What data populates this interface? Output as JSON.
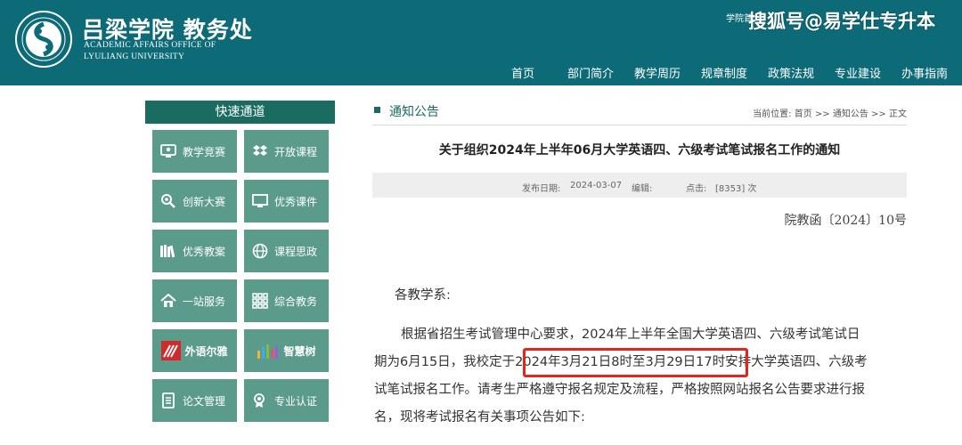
{
  "header": {
    "logo_cn": "吕梁学院 教务处",
    "logo_en_line1": "ACADEMIC AFFAIRS OFFICE OF",
    "logo_en_line2": "LYULIANG UNIVERSITY",
    "top_links": "学院首",
    "watermark": "搜狐号@易学仕专升本",
    "brand_color": "#0d6b77",
    "nav": [
      "首页",
      "部门简介",
      "教学周历",
      "规章制度",
      "政策法规",
      "专业建设",
      "办事指南"
    ]
  },
  "sidebar": {
    "title": "快速通道",
    "items": [
      {
        "label": "教学竞赛",
        "icon": "monitor-person-icon"
      },
      {
        "label": "开放课程",
        "icon": "dropbox-icon"
      },
      {
        "label": "创新大赛",
        "icon": "lightbulb-search-icon"
      },
      {
        "label": "优秀课件",
        "icon": "monitor-icon"
      },
      {
        "label": "优秀教案",
        "icon": "books-icon"
      },
      {
        "label": "课程思政",
        "icon": "globe-icon"
      },
      {
        "label": "一站服务",
        "icon": "house-icon"
      },
      {
        "label": "综合教务",
        "icon": "grid-icon"
      },
      {
        "label": "外语尔雅",
        "icon": "chaoxing-erya-logo"
      },
      {
        "label": "智慧树",
        "icon": "zhihuishu-logo"
      },
      {
        "label": "论文管理",
        "icon": "document-icon"
      },
      {
        "label": "专业认证",
        "icon": "certificate-icon"
      }
    ],
    "button_color": "#5b9b8c",
    "title_color": "#1a6b60"
  },
  "main": {
    "section_title": "通知公告",
    "breadcrumb": {
      "prefix": "当前位置:",
      "home": "首页",
      "sep": ">>",
      "notices": "通知公告",
      "current": "正文"
    },
    "article": {
      "title": "关于组织2024年上半年06月大学英语四、六级考试笔试报名工作的通知",
      "publish_label": "发布日期:",
      "publish_date": "2024-03-07",
      "editor_label": "编辑:",
      "clicks_label": "点击:",
      "clicks": "[8353] 次",
      "doc_number": "院教函〔2024〕10号",
      "greeting": "各教学系:",
      "body_lines": [
        "根据省招生考试管理中心要求，2024年上半年全国大学英语四、六级考试笔试日",
        "期为6月15日，我校定于2024年3月21日8时至3月29日17时安排大学英语四、六级考",
        "试笔试报名工作。请考生严格遵守报名规定及流程，严格按照网站报名公告要求进行报",
        "名，现将考试报名有关事项公告如下:"
      ],
      "highlighted_text": "2024年3月21日8时至3月29日17时",
      "highlight_color": "#e0261d"
    }
  }
}
